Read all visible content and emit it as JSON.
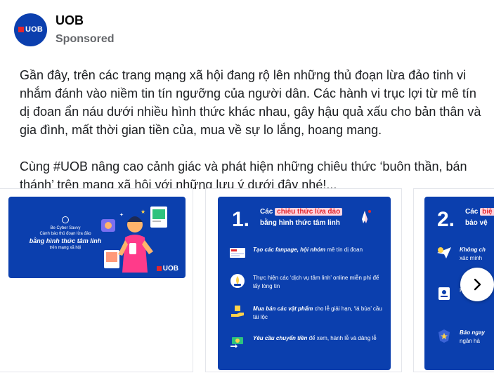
{
  "post": {
    "page_name": "UOB",
    "sponsored_label": "Sponsored",
    "avatar_logo_text": "UOB",
    "paragraphs": [
      "Gần đây, trên các trang mạng xã hội đang rộ lên những thủ đoạn lừa đảo tinh vi nhắm đánh vào niềm tin tín ngưỡng của người dân. Các hành vi trục lợi từ mê tín dị đoan ẩn náu dưới nhiều hình thức khác nhau, gây hậu quả xấu cho bản thân và gia đình, mất thời gian tiền của, mua về sự lo lắng, hoang mang.",
      "Cùng #UOB nâng cao cảnh giác và phát hiện những chiêu thức ‘buôn thần, bán thánh’ trên mạng xã hội với những lưu ý dưới đây nhé!..."
    ]
  },
  "carousel": {
    "card1": {
      "tagline": "Be Cyber Savvy",
      "line1": "Cảnh báo thủ đoạn lừa đảo",
      "title": "bằng hình thức tâm linh",
      "line2": "trên mạng xã hội",
      "logo_text": "UOB"
    },
    "card2": {
      "number": "1.",
      "head_pre": "Các",
      "head_hl": "chiêu thức lừa đảo",
      "head_line2": "bằng hình thức tâm linh",
      "items": [
        {
          "bold": "Tạo các fanpage, hội nhóm",
          "rest": " mê tín dị đoan"
        },
        {
          "bold": "",
          "rest": "Thực hiện các ‘dịch vụ tâm linh’ online miễn phí để lấy lòng tin"
        },
        {
          "bold": "Mua bán các vật phẩm",
          "rest": " cho lễ giải hạn, ‘lá bùa’ cầu tài lộc"
        },
        {
          "bold": "Yêu cầu chuyển tiền",
          "rest": " để xem, hành lễ và dâng lễ"
        }
      ]
    },
    "card3": {
      "number": "2.",
      "head_pre": "Các",
      "head_hl": "biệ",
      "head_line2": "bảo vệ",
      "items": [
        {
          "bold": "Không ch",
          "rest": "xác minh"
        },
        {
          "bold": "",
          "rest": "Kh"
        },
        {
          "bold": "Báo ngay",
          "rest": "ngân hà"
        }
      ]
    }
  },
  "icons": {
    "next": "chevron-right-icon"
  },
  "colors": {
    "brand_blue": "#0b3fae",
    "brand_red": "#e3262d",
    "accent_yellow": "#ffd24a"
  }
}
